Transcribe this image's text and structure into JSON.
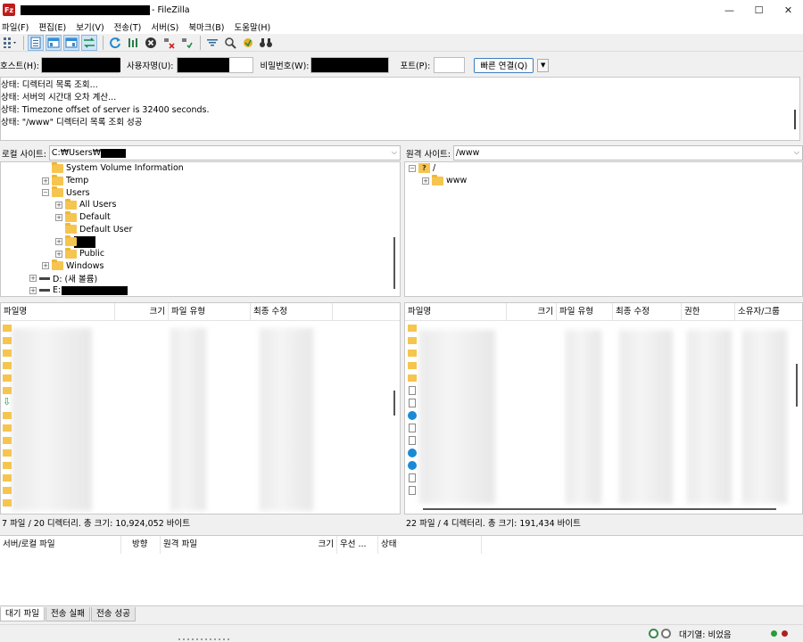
{
  "window": {
    "title_suffix": "- FileZilla",
    "app_icon": "Fz",
    "controls": {
      "minimize": "—",
      "maximize": "☐",
      "close": "✕"
    }
  },
  "menu": [
    "파일(F)",
    "편집(E)",
    "보기(V)",
    "전송(T)",
    "서버(S)",
    "북마크(B)",
    "도움말(H)"
  ],
  "quickconnect": {
    "host_label": "호스트(H):",
    "user_label": "사용자명(U):",
    "pass_label": "비밀번호(W):",
    "port_label": "포트(P):",
    "port_value": "",
    "connect_label": "빠른 연결(Q)"
  },
  "log": [
    "상태:  디렉터리 목록 조회...",
    "상태:  서버의 시간대 오차 계산...",
    "상태:  Timezone offset of server is 32400 seconds.",
    "상태:  \"/www\" 디렉터리 목록 조회 성공"
  ],
  "local": {
    "site_label": "로컬 사이트:",
    "path": "C:₩Users₩",
    "tree": [
      {
        "label": "System Volume Information",
        "exp": ""
      },
      {
        "label": "Temp",
        "exp": "+"
      },
      {
        "label": "Users",
        "exp": "−"
      },
      {
        "label": "All Users",
        "exp": "+"
      },
      {
        "label": "Default",
        "exp": "+"
      },
      {
        "label": "Default User",
        "exp": ""
      },
      {
        "label": "",
        "exp": "+"
      },
      {
        "label": "Public",
        "exp": "+"
      },
      {
        "label": "Windows",
        "exp": "+"
      },
      {
        "label": "D: (새 볼륨)",
        "exp": "+"
      },
      {
        "label": "E:",
        "exp": "+"
      }
    ],
    "columns": [
      "파일명",
      "크기",
      "파일 유형",
      "최종 수정"
    ],
    "summary": "7 파일 / 20 디렉터리. 총 크기: 10,924,052 바이트"
  },
  "remote": {
    "site_label": "원격 사이트:",
    "path": "/www",
    "tree": [
      {
        "label": "/",
        "exp": "−"
      },
      {
        "label": "www",
        "exp": "+"
      }
    ],
    "columns": [
      "파일명",
      "크기",
      "파일 유형",
      "최종 수정",
      "권한",
      "소유자/그룹"
    ],
    "summary": "22 파일 / 4 디렉터리. 총 크기: 191,434 바이트"
  },
  "queue": {
    "columns": [
      "서버/로컬 파일",
      "방향",
      "원격 파일",
      "크기",
      "우선 ...",
      "상태"
    ],
    "tabs": [
      "대기 파일",
      "전송 실패",
      "전송 성공"
    ]
  },
  "statusbar": {
    "queue_text": "대기열: 비었음"
  },
  "colors": {
    "folder": "#f5c54f",
    "accent": "#3c7fc0",
    "app_icon_red": "#bf1c1c"
  }
}
